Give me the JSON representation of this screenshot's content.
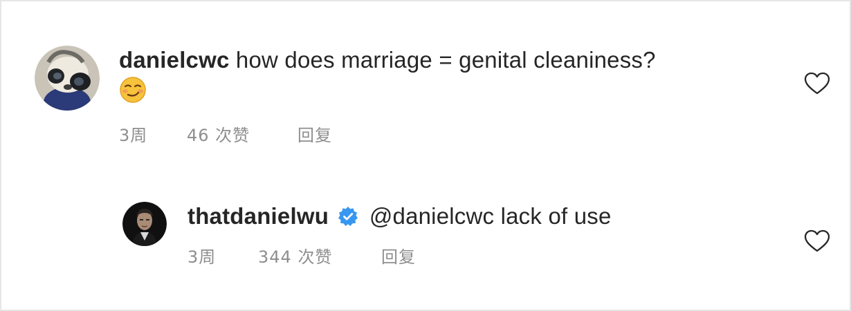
{
  "comments": [
    {
      "username": "danielcwc",
      "text": "how does marriage = genital cleaniness?",
      "emoji": "smirking-face",
      "time": "3周",
      "likes": "46 次赞",
      "reply_label": "回复",
      "avatar_icon": "panda-avatar"
    },
    {
      "username": "thatdanielwu",
      "verified": true,
      "text": "@danielcwc lack of use",
      "time": "3周",
      "likes": "344 次赞",
      "reply_label": "回复",
      "avatar_icon": "portrait-avatar"
    }
  ],
  "colors": {
    "text": "#262626",
    "meta": "#8e8e8e",
    "verified": "#3897f0"
  },
  "icons": {
    "like": "heart-outline-icon",
    "verified": "verified-badge-icon"
  }
}
